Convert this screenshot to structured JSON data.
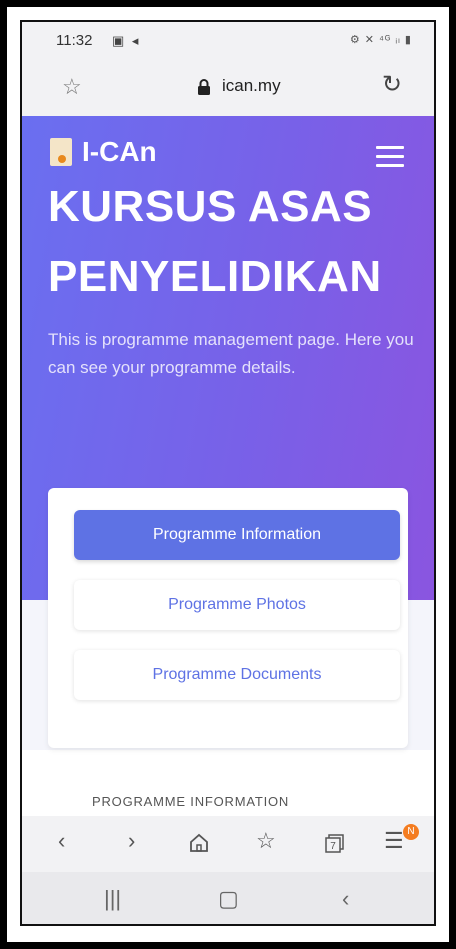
{
  "status_bar": {
    "time": "11:32",
    "left_icons": "▣ ◂",
    "right_icons": "⚙ ✕ ⁴ᴳ ᵢₗ ▮"
  },
  "browser": {
    "url": "ican.my"
  },
  "header": {
    "brand": "I-CAn"
  },
  "hero": {
    "title": "KURSUS ASAS PENYELIDIKAN",
    "description": "This is programme management page. Here you can see your programme details."
  },
  "menu": {
    "items": [
      {
        "label": "Programme Information",
        "active": true
      },
      {
        "label": "Programme Photos",
        "active": false
      },
      {
        "label": "Programme Documents",
        "active": false
      }
    ]
  },
  "section": {
    "label": "PROGRAMME INFORMATION"
  },
  "browser_toolbar": {
    "tabs_count": "7",
    "menu_badge": "N"
  },
  "colors": {
    "primary": "#5e72e4",
    "hero_start": "#6a6ff0",
    "hero_end": "#8a55e0",
    "badge": "#f47c20"
  },
  "icons": {
    "status": [
      "gallery-icon",
      "location-icon",
      "signal-icon",
      "battery-icon"
    ],
    "browser": [
      "bookmark-star-icon",
      "lock-icon",
      "reload-icon"
    ],
    "toolbar": [
      "back-icon",
      "forward-icon",
      "home-icon",
      "bookmarks-icon",
      "tabs-icon",
      "menu-icon"
    ],
    "nav": [
      "recents-icon",
      "home-button-icon",
      "back-nav-icon"
    ]
  }
}
